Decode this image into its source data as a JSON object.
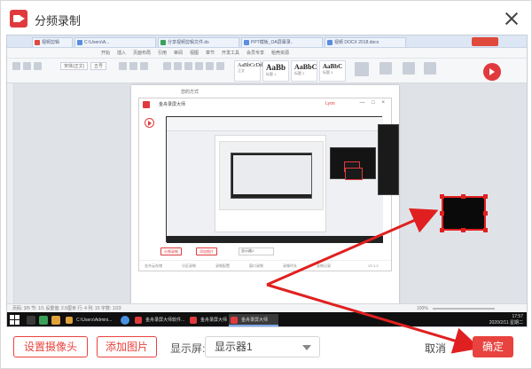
{
  "window": {
    "title": "分频录制"
  },
  "preview": {
    "browser_tabs": [
      "视频剪辑",
      "C:\\Users\\A...",
      "分享视频剪辑文件.ds",
      "PPT模板_OA屏幕录..",
      "视频 DOCX 2018.docx"
    ],
    "ribbon_menu": [
      "开始",
      "插入",
      "页面布局",
      "引用",
      "审阅",
      "视图",
      "章节",
      "开发工具",
      "会员专享",
      "稻壳资源"
    ],
    "ribbon_active": "开始",
    "font_name": "宋体(正文)",
    "font_size": "五号",
    "styles": [
      {
        "sample": "AaBbCcDd",
        "name": "正文"
      },
      {
        "sample": "AaBb",
        "name": "标题 1"
      },
      {
        "sample": "AaBbC",
        "name": "标题 2"
      },
      {
        "sample": "AaBbC",
        "name": "标题 3"
      }
    ],
    "doc_text": "您的方式",
    "recorder_title": "金舟录屏大师",
    "recorder_user": "Lyon",
    "recorder_buttons": [
      "分频录制",
      "添加图片"
    ],
    "recorder_select": "显示器1",
    "recorder_footer": [
      "金舟云存储",
      "分区录制",
      "录制配置",
      "窗口录制",
      "录像时长",
      "录制记录"
    ],
    "recorder_version": "V2.1.2",
    "status_text": "页码: 3/5  节: 1/1  设置值: 2.5厘米  行: 4  列: 15  字数: 1/23",
    "status_zoom": "100%",
    "taskbar_items": [
      {
        "label": "C:\\Users\\Admini...",
        "kind": "folder"
      },
      {
        "label": "金舟录屏大师软件...",
        "kind": "red"
      },
      {
        "label": "金舟录屏大师软件",
        "kind": "red"
      },
      {
        "label": "金舟录屏大师",
        "kind": "red"
      }
    ],
    "taskbar_time": "17:57",
    "taskbar_date": "2020/2/11 星期二"
  },
  "footer": {
    "camera_button": "设置摄像头",
    "add_image_button": "添加图片",
    "display_label": "显示屏:",
    "display_value": "显示器1",
    "cancel_button": "取消",
    "ok_button": "确定"
  },
  "colors": {
    "accent": "#e8433f",
    "annotation": "#e02020"
  }
}
